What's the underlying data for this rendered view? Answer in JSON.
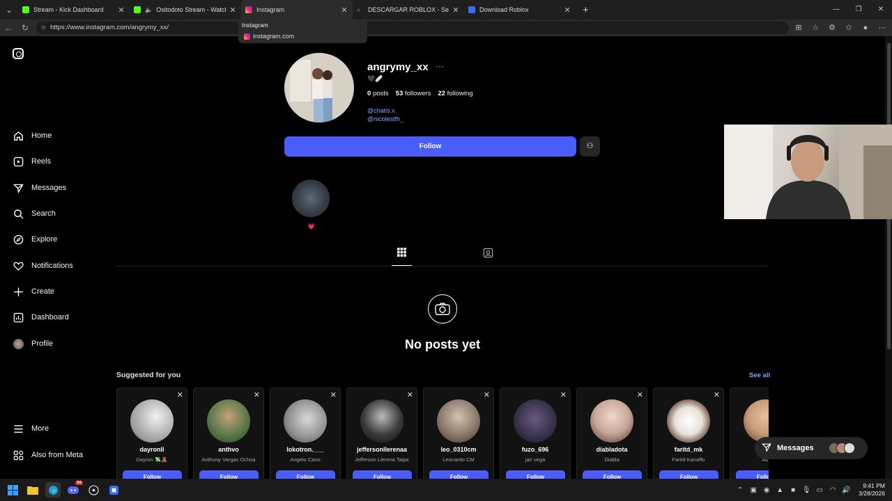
{
  "browser": {
    "tabs": [
      {
        "title": "Stream - Kick Dashboard",
        "favicon_color": "#53fc18",
        "active": false
      },
      {
        "title": "Ositodoto Stream - Watch Live",
        "favicon_color": "#53fc18",
        "active": false
      },
      {
        "title": "Instagram",
        "favicon_color": "#ee2a7b",
        "active": true
      },
      {
        "title": "DESCARGAR ROBLOX - Search",
        "favicon_color": "#5aa0ff",
        "active": false
      },
      {
        "title": "Download Roblox",
        "favicon_color": "#3b6cf5",
        "active": false
      }
    ],
    "url": "https://www.instagram.com/angrymy_xx/",
    "hovercard": {
      "title": "Instagram",
      "domain": "instagram.com"
    }
  },
  "sidebar": {
    "items": [
      {
        "label": "Home",
        "icon": "home-icon"
      },
      {
        "label": "Reels",
        "icon": "reels-icon"
      },
      {
        "label": "Messages",
        "icon": "messages-icon"
      },
      {
        "label": "Search",
        "icon": "search-icon"
      },
      {
        "label": "Explore",
        "icon": "explore-icon"
      },
      {
        "label": "Notifications",
        "icon": "heart-icon"
      },
      {
        "label": "Create",
        "icon": "plus-icon"
      },
      {
        "label": "Dashboard",
        "icon": "dashboard-icon"
      },
      {
        "label": "Profile",
        "icon": "avatar"
      }
    ],
    "bottom": [
      {
        "label": "More",
        "icon": "menu-icon"
      },
      {
        "label": "Also from Meta",
        "icon": "meta-icon"
      }
    ]
  },
  "profile": {
    "username": "angrymy_xx",
    "bio": "🖤🩹",
    "posts_count": "0",
    "posts_label": "posts",
    "followers_count": "53",
    "followers_label": "followers",
    "following_count": "22",
    "following_label": "following",
    "mentions": [
      "@chatis.x",
      "@nicolestfh_"
    ],
    "follow_label": "Follow",
    "highlight_label": "💗"
  },
  "content": {
    "empty_title": "No posts yet"
  },
  "suggested": {
    "title": "Suggested for you",
    "see_all": "See all",
    "follow_label": "Follow",
    "cards": [
      {
        "username": "dayronll",
        "name": "Dayron 💸🧸",
        "color": "#d9d9d9"
      },
      {
        "username": "anthvo",
        "name": "Anthony Vargas Ochoa",
        "color": "#5b7a4a"
      },
      {
        "username": "lokotron.___",
        "name": "Angelo Cano",
        "color": "#bdbdbd"
      },
      {
        "username": "jeffersonllerenaa",
        "name": "Jefferson Llerena Taipe",
        "color": "#3a3a3a"
      },
      {
        "username": "leo_0310cm",
        "name": "Leonardo CM",
        "color": "#8a7a6a"
      },
      {
        "username": "fuzo_696",
        "name": "jair vega",
        "color": "#3a3350"
      },
      {
        "username": "diabladota",
        "name": "Diabla",
        "color": "#c8a89a"
      },
      {
        "username": "faritd_mk",
        "name": "Faritd Kanaffo",
        "color": "#e8e2d8"
      },
      {
        "username": "a",
        "name": "As",
        "color": "#c89a7a"
      }
    ]
  },
  "messages_pill": {
    "label": "Messages"
  },
  "taskbar": {
    "time": "9:41 PM",
    "date": "3/28/2026",
    "discord_badge": "94"
  }
}
